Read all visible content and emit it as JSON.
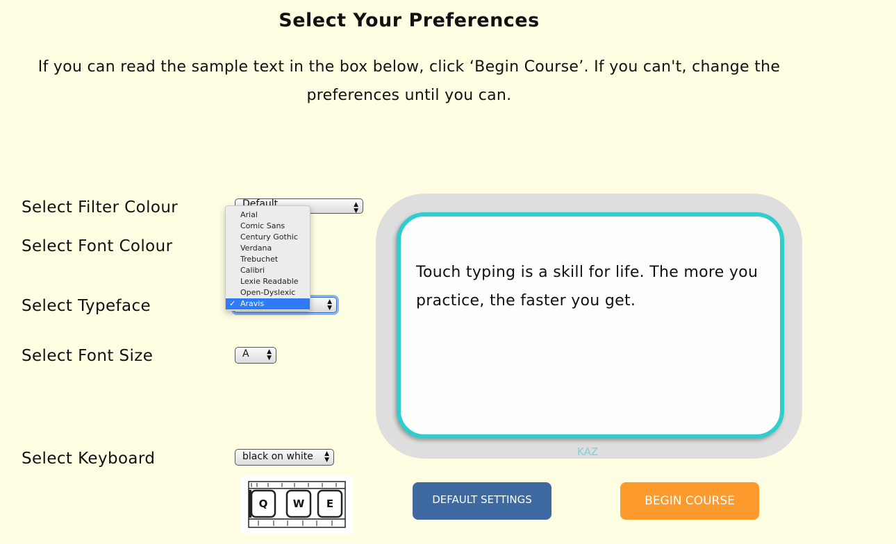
{
  "header": {
    "title": "Select Your Preferences",
    "intro": "If you can read the sample text in the box below, click ‘Begin Course’. If you can't, change the preferences until you can."
  },
  "preferences": {
    "filter_colour": {
      "label": "Select Filter Colour",
      "value": "Default"
    },
    "font_colour": {
      "label": "Select Font Colour"
    },
    "typeface": {
      "label": "Select Typeface",
      "options": [
        "Arial",
        "Comic Sans",
        "Century Gothic",
        "Verdana",
        "Trebuchet",
        "Calibri",
        "Lexie Readable",
        "Open-Dyslexic",
        "Aravis"
      ],
      "selected": "Aravis",
      "check_glyph": "✓"
    },
    "font_size": {
      "label": "Select Font Size",
      "value": "A"
    },
    "keyboard": {
      "label": "Select Keyboard",
      "value": "black on white",
      "keys": [
        "Q",
        "W",
        "E"
      ]
    }
  },
  "preview": {
    "sample_text": "Touch typing is a skill for life. The more you practice, the faster you get.",
    "brand": "KAZ"
  },
  "buttons": {
    "default_settings": "DEFAULT SETTINGS",
    "begin_course": "BEGIN COURSE"
  },
  "colors": {
    "background": "#fffee2",
    "preview_border": "#2fcdcb",
    "default_button": "#3f6aa1",
    "begin_button": "#fd9a2e"
  }
}
